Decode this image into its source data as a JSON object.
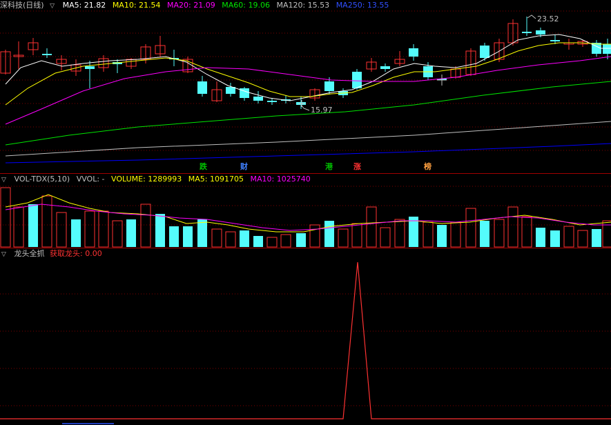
{
  "colors": {
    "up": "#ff3232",
    "down": "#54fcfc",
    "ma5": "#ffffff",
    "ma10": "#ffff00",
    "ma20": "#ff00ff",
    "ma60": "#00e600",
    "ma120": "#c0c0c0",
    "ma250": "#0000ff",
    "vol_ma5": "#ffff00",
    "vol_ma10": "#ff00ff",
    "label": "#ff3232",
    "grid": "#800000"
  },
  "price_header": {
    "title": "深科技(日线)",
    "ma5": "MA5: 21.82",
    "ma10": "MA10: 21.54",
    "ma20": "MA20: 21.09",
    "ma60": "MA60: 19.06",
    "ma120": "MA120: 15.53",
    "ma250": "MA250: 13.55"
  },
  "annotations": {
    "high": "23.52",
    "low": "15.97"
  },
  "badges": [
    {
      "text": "跌",
      "color": "#00c000",
      "bg": "#004000"
    },
    {
      "text": "财",
      "color": "#4080ff",
      "bg": "#000000"
    },
    {
      "text": "港",
      "color": "#00c000",
      "bg": "#004000"
    },
    {
      "text": "涨",
      "color": "#ff3232",
      "bg": "#400000"
    },
    {
      "text": "榜",
      "color": "#ffa040",
      "bg": "#402000"
    }
  ],
  "vol_header": {
    "title": "VOL-TDX(5,10)",
    "vvol": "VVOL: -",
    "volume": "VOLUME: 1289993",
    "ma5": "MA5: 1091705",
    "ma10": "MA10: 1025740"
  },
  "ind_header": {
    "title": "龙头全抓",
    "value": "获取龙头: 0.00"
  }
}
